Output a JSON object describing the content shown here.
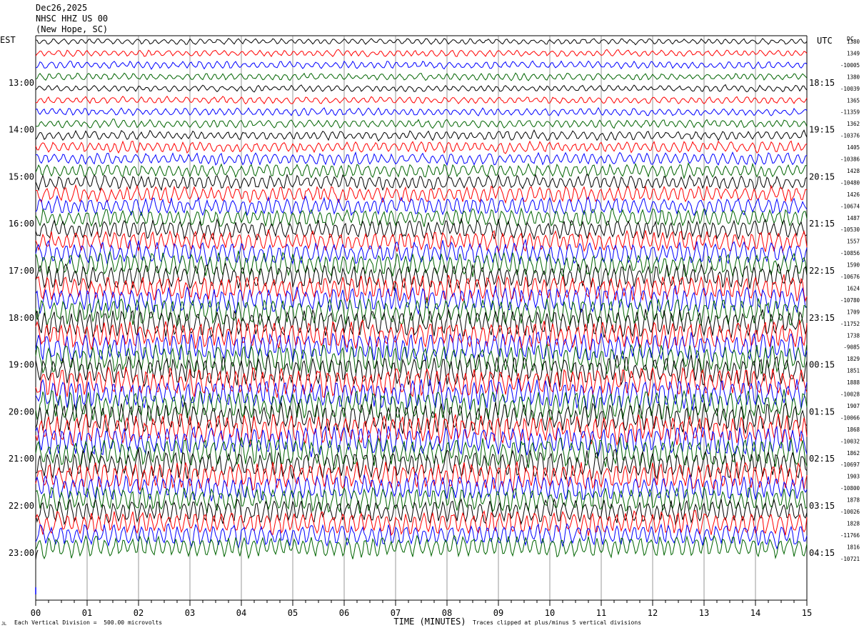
{
  "header": {
    "date": "Dec26,2025",
    "station": "NHSC HHZ US 00",
    "location": "(New Hope, SC)"
  },
  "left_zone": "EST",
  "right_zone": "UTC",
  "dc_label": "DC",
  "footer": {
    "scale": "Each Vertical Division =  500.00 microvolts",
    "clip": "Traces clipped at plus/minus 5 vertical divisions",
    "corner": "JL"
  },
  "colors": {
    "trace_cycle": [
      "#000000",
      "#ff0000",
      "#0000ff",
      "#006400"
    ],
    "grid": "#000000"
  },
  "chart_data": {
    "type": "line",
    "xlabel": "TIME (MINUTES)",
    "x_ticks": [
      "00",
      "01",
      "02",
      "03",
      "04",
      "05",
      "06",
      "07",
      "08",
      "09",
      "10",
      "11",
      "12",
      "13",
      "14",
      "15"
    ],
    "xlim": [
      0,
      15
    ],
    "left_hour_labels": [
      "13:00",
      "14:00",
      "15:00",
      "16:00",
      "17:00",
      "18:00",
      "19:00",
      "20:00",
      "21:00",
      "22:00",
      "23:00"
    ],
    "right_hour_labels": [
      "18:15",
      "19:15",
      "20:15",
      "21:15",
      "22:15",
      "23:15",
      "00:15",
      "01:15",
      "02:15",
      "03:15",
      "04:15"
    ],
    "trace_count": 44,
    "trace_minutes": 15,
    "dc_offsets": [
      "1380",
      "1349",
      "-10005",
      "1380",
      "-10039",
      "1365",
      "-11359",
      "1362",
      "-10376",
      "1405",
      "-10386",
      "1428",
      "-10480",
      "1426",
      "-10674",
      "1487",
      "-10530",
      "1557",
      "-10856",
      "1590",
      "-10676",
      "1624",
      "-10780",
      "1709",
      "-11752",
      "1738",
      "-9085",
      "1829",
      "1851",
      "1888",
      "-10028",
      "1907",
      "-10066",
      "1868",
      "-10032",
      "1862",
      "-10697",
      "1903",
      "-10800",
      "1878",
      "-10026",
      "1828",
      "-11766",
      "1816",
      "-10721"
    ],
    "trace_amplitude_divisions": [
      1.0,
      1.1,
      1.3,
      1.2,
      1.1,
      1.2,
      1.3,
      1.4,
      1.6,
      1.9,
      2.1,
      2.3,
      2.5,
      2.7,
      2.9,
      3.1,
      3.3,
      3.5,
      3.8,
      4.0,
      4.2,
      4.4,
      4.5,
      4.6,
      4.7,
      4.8,
      4.8,
      4.9,
      5.0,
      5.0,
      5.0,
      5.0,
      5.0,
      5.0,
      5.0,
      4.9,
      4.8,
      4.6,
      4.4,
      4.2,
      4.1,
      4.0,
      3.8,
      3.6
    ],
    "clip_divisions": 5,
    "microvolts_per_division": 500.0
  }
}
